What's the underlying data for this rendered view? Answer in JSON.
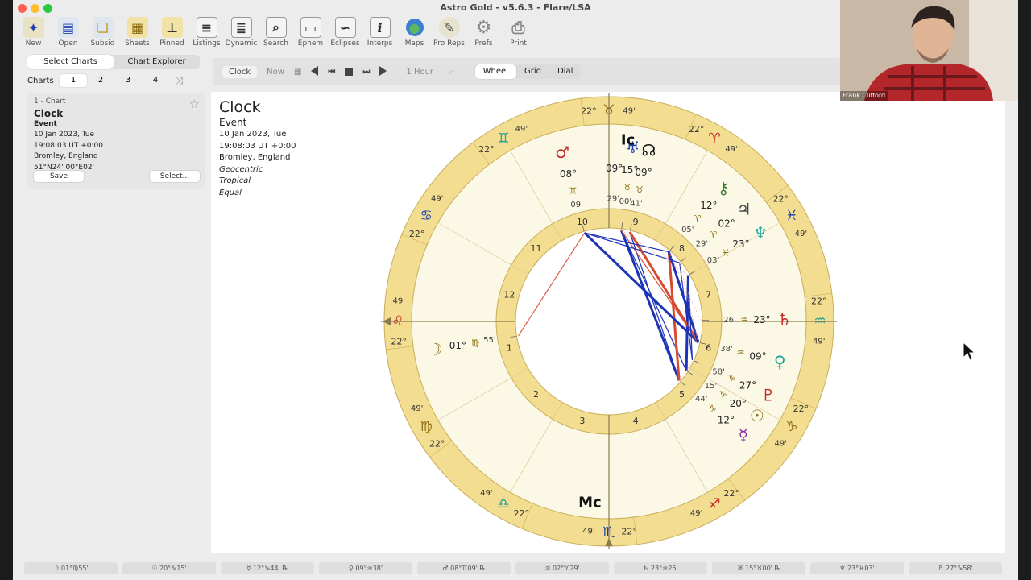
{
  "window": {
    "title": "Astro Gold - v5.6.3 - Flare/LSA"
  },
  "toolbar": {
    "items": [
      {
        "label": "New"
      },
      {
        "label": "Open"
      },
      {
        "label": "Subsid"
      },
      {
        "label": "Sheets"
      },
      {
        "label": "Pinned"
      },
      {
        "label": "Listings"
      },
      {
        "label": "Dynamic"
      },
      {
        "label": "Search"
      },
      {
        "label": "Ephem"
      },
      {
        "label": "Eclipses"
      },
      {
        "label": "Interps"
      },
      {
        "label": "Maps"
      },
      {
        "label": "Pro Reps"
      },
      {
        "label": "Prefs"
      },
      {
        "label": "Print"
      }
    ]
  },
  "sidebar": {
    "tabs": {
      "select": "Select Charts",
      "explorer": "Chart Explorer"
    },
    "charts_label": "Charts",
    "chart_nums": [
      "1",
      "2",
      "3",
      "4"
    ],
    "card": {
      "header": "1 - Chart",
      "name": "Clock",
      "type": "Event",
      "date": "10 Jan 2023, Tue",
      "time": "19:08:03 UT +0:00",
      "place": "Bromley, England",
      "coords": "51°N24' 00°E02'",
      "save": "Save",
      "select": "Select..."
    }
  },
  "chartbar": {
    "clock": "Clock",
    "now": "Now",
    "step": "1 Hour",
    "views": [
      "Wheel",
      "Grid",
      "Dial"
    ]
  },
  "chart_info": {
    "title": "Clock",
    "type": "Event",
    "date": "10 Jan 2023, Tue",
    "time": "19:08:03 UT +0:00",
    "place": "Bromley, England",
    "geocentric": "Geocentric",
    "tropical": "Tropical",
    "equal": "Equal"
  },
  "wheel": {
    "asc_deg": 142.8,
    "cusp_labels": [
      {
        "d": "22°",
        "m": "49'"
      }
    ],
    "houses": [
      "1",
      "2",
      "3",
      "4",
      "5",
      "6",
      "7",
      "8",
      "9",
      "10",
      "11",
      "12"
    ],
    "signs": [
      {
        "glyph": "♌",
        "color": "#c62828"
      },
      {
        "glyph": "♍",
        "color": "#8d6e0f"
      },
      {
        "glyph": "♎",
        "color": "#1aa39b"
      },
      {
        "glyph": "♏",
        "color": "#1a3fae"
      },
      {
        "glyph": "♐",
        "color": "#c62828"
      },
      {
        "glyph": "♑",
        "color": "#8d6e0f"
      },
      {
        "glyph": "♒",
        "color": "#1aa39b"
      },
      {
        "glyph": "♓",
        "color": "#1a3fae"
      },
      {
        "glyph": "♈",
        "color": "#c62828"
      },
      {
        "glyph": "♉",
        "color": "#8d6e0f"
      },
      {
        "glyph": "♊",
        "color": "#1aa39b"
      },
      {
        "glyph": "♋",
        "color": "#1a3fae"
      }
    ],
    "planets": [
      {
        "name": "moon",
        "glyph": "☽",
        "deg": "01°",
        "sign": "♍",
        "min": "55'",
        "lon": 151.9,
        "color": "#8d6e0f"
      },
      {
        "name": "sun",
        "glyph": "☉",
        "deg": "20°",
        "sign": "♑",
        "min": "15'",
        "lon": 290.3,
        "color": "#8d6e0f"
      },
      {
        "name": "mercury",
        "glyph": "☿",
        "deg": "12°",
        "sign": "♑",
        "min": "44'",
        "lon": 282.7,
        "color": "#8e24aa"
      },
      {
        "name": "venus",
        "glyph": "♀",
        "deg": "09°",
        "sign": "♒",
        "min": "38'",
        "lon": 309.6,
        "color": "#1aa39b"
      },
      {
        "name": "mars",
        "glyph": "♂",
        "deg": "08°",
        "sign": "♊",
        "min": "09'",
        "lon": 68.2,
        "color": "#c62828"
      },
      {
        "name": "jupiter",
        "glyph": "♃",
        "deg": "02°",
        "sign": "♈",
        "min": "29'",
        "lon": 2.5,
        "color": "#444444"
      },
      {
        "name": "saturn",
        "glyph": "♄",
        "deg": "23°",
        "sign": "♒",
        "min": "26'",
        "lon": 323.4,
        "color": "#c62828"
      },
      {
        "name": "uranus",
        "glyph": "♅",
        "deg": "15°",
        "sign": "♉",
        "min": "00'",
        "lon": 45.0,
        "color": "#1a3fae"
      },
      {
        "name": "neptune",
        "glyph": "♆",
        "deg": "23°",
        "sign": "♓",
        "min": "03'",
        "lon": 353.1,
        "color": "#1aa39b"
      },
      {
        "name": "pluto",
        "glyph": "♇",
        "deg": "27°",
        "sign": "♑",
        "min": "58'",
        "lon": 298.0,
        "color": "#c62828"
      },
      {
        "name": "node",
        "glyph": "☊",
        "deg": "09°",
        "sign": "♉",
        "min": "41'",
        "lon": 39.7,
        "color": "#111111"
      },
      {
        "name": "chiron",
        "glyph": "⚷",
        "deg": "12°",
        "sign": "♈",
        "min": "05'",
        "lon": 12.1,
        "color": "#2e7d32"
      }
    ],
    "angles": {
      "mc": "Mc",
      "ic": "Ic",
      "ic_deg": "09°",
      "ic_min": "29'"
    }
  },
  "statusbar": [
    "☽ 01°♍55'",
    "☉ 20°♑15'",
    "☿ 12°♑44' ℞",
    "♀ 09°♒38'",
    "♂ 08°♊09' ℞",
    "♃ 02°♈29'",
    "♄ 23°♒26'",
    "♅ 15°♉00' ℞",
    "♆ 23°♓03'",
    "♇ 27°♑58'"
  ],
  "video": {
    "name": "Frank Clifford"
  },
  "colors": {
    "wheel_gold": "#f3dd91",
    "wheel_inner": "#fcf8e6",
    "red_aspect": "#d84a2f",
    "blue_aspect": "#1d33b8"
  }
}
